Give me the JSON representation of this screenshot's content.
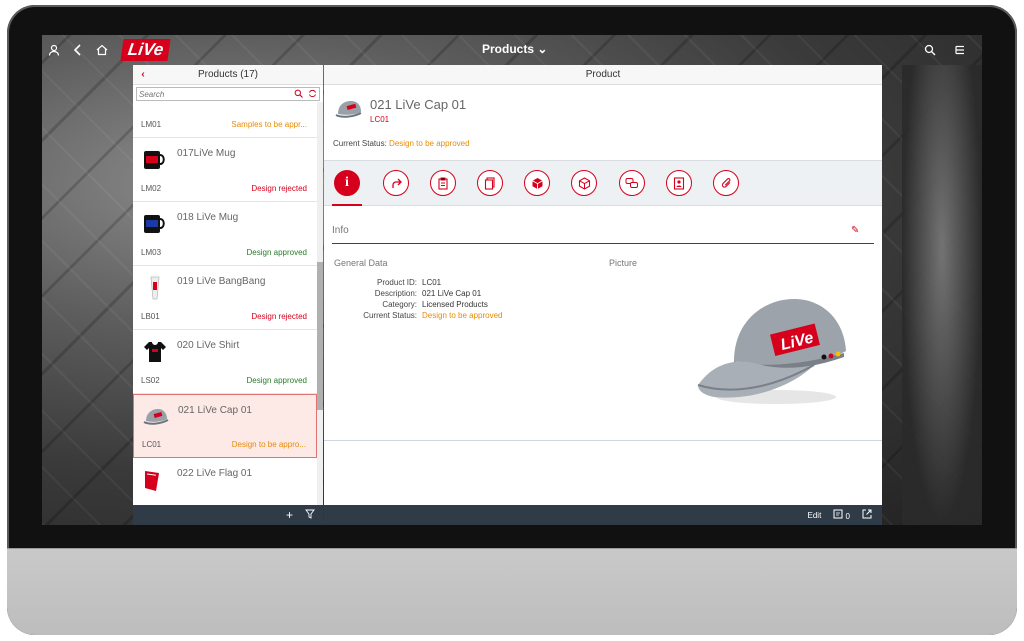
{
  "shell": {
    "logo": "LiVe",
    "title": "Products"
  },
  "master": {
    "title": "Products (17)",
    "search_placeholder": "Search",
    "items": [
      {
        "title": "",
        "id": "LM01",
        "status": "Samples to be appr..."
      },
      {
        "title": "017LiVe Mug",
        "id": "LM02",
        "status": "Design rejected"
      },
      {
        "title": "018 LiVe Mug",
        "id": "LM03",
        "status": "Design approved"
      },
      {
        "title": "019 LiVe BangBang",
        "id": "LB01",
        "status": "Design rejected"
      },
      {
        "title": "020 LiVe Shirt",
        "id": "LS02",
        "status": "Design approved"
      },
      {
        "title": "021 LiVe Cap 01",
        "id": "LC01",
        "status": "Design to be appro..."
      },
      {
        "title": "022 LiVe Flag 01",
        "id": "",
        "status": ""
      }
    ]
  },
  "detail": {
    "header": "Product",
    "object_title": "021 LiVe Cap 01",
    "object_number": "LC01",
    "current_status_label": "Current Status:",
    "current_status_value": "Design to be approved",
    "tab_info_glyph": "i",
    "section_title": "Info",
    "general_data_title": "General Data",
    "picture_title": "Picture",
    "fields": {
      "product_id_label": "Product ID:",
      "product_id": "LC01",
      "description_label": "Description:",
      "description": "021 LiVe Cap 01",
      "category_label": "Category:",
      "category": "Licensed Products",
      "status_label": "Current Status:",
      "status": "Design to be approved"
    },
    "cap_logo": "LiVe",
    "footer": {
      "edit_label": "Edit",
      "notes_count": "0"
    }
  },
  "colors": {
    "accent": "#d6001c",
    "status_orange": "#e78c07",
    "status_green": "#2b7c2b",
    "footer_bg": "#2f3c48"
  }
}
